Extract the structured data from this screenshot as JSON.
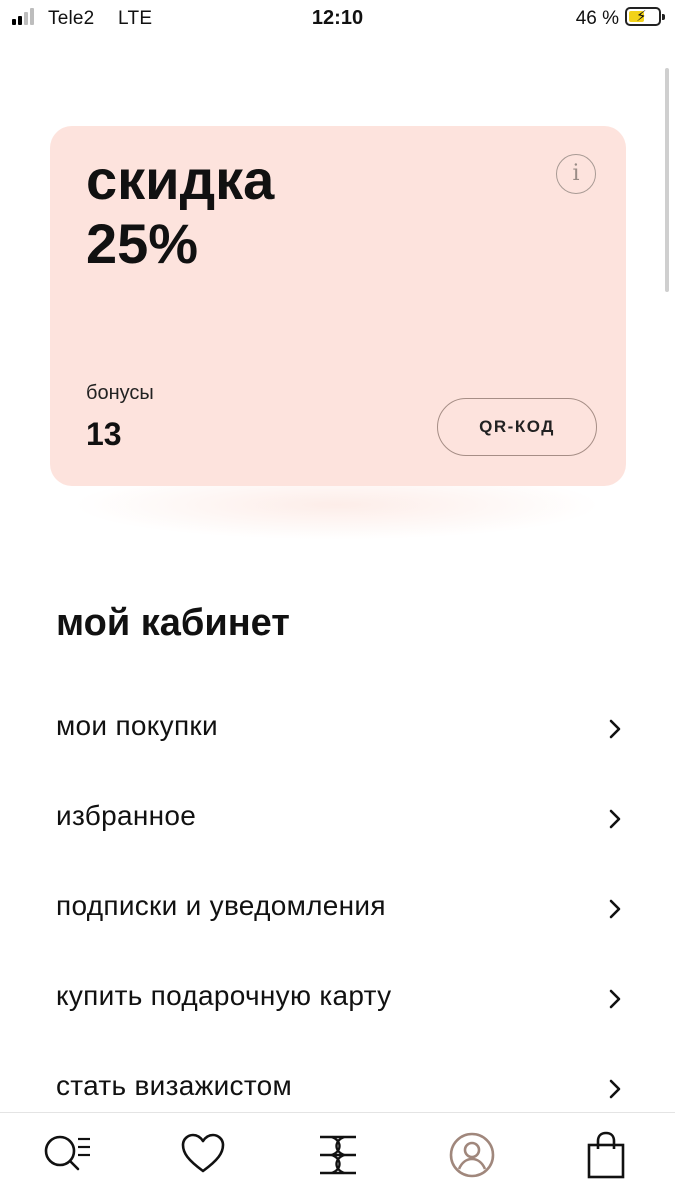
{
  "status_bar": {
    "carrier": "Tele2",
    "network": "LTE",
    "time": "12:10",
    "battery_percent": "46 %",
    "battery_level": 0.46
  },
  "bonus_card": {
    "discount_line1": "скидка",
    "discount_line2": "25%",
    "info_icon": "i",
    "bonus_label": "бонусы",
    "bonus_value": "13",
    "qr_button_label": "QR-КОД",
    "background_color": "#fde3dd"
  },
  "cabinet": {
    "title": "мой кабинет",
    "items": [
      {
        "label": "мои покупки"
      },
      {
        "label": "избранное"
      },
      {
        "label": "подписки и уведомления"
      },
      {
        "label": "купить подарочную карту"
      },
      {
        "label": "стать визажистом"
      }
    ]
  },
  "tab_bar": {
    "tabs": [
      {
        "icon": "search-catalog-icon"
      },
      {
        "icon": "heart-icon"
      },
      {
        "icon": "brand-logo-icon"
      },
      {
        "icon": "profile-icon",
        "active": true
      },
      {
        "icon": "shopping-bag-icon"
      }
    ],
    "active_color": "#a0877c"
  }
}
